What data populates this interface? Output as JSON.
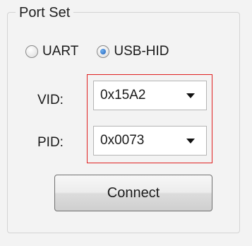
{
  "port_set": {
    "title": "Port Set",
    "mode_options": [
      {
        "label": "UART",
        "selected": false
      },
      {
        "label": "USB-HID",
        "selected": true
      }
    ],
    "vid": {
      "label": "VID:",
      "value": "0x15A2"
    },
    "pid": {
      "label": "PID:",
      "value": "0x0073"
    },
    "connect_label": "Connect"
  },
  "colors": {
    "highlight_border": "#e02020",
    "radio_selected": "#1f5fb8"
  }
}
